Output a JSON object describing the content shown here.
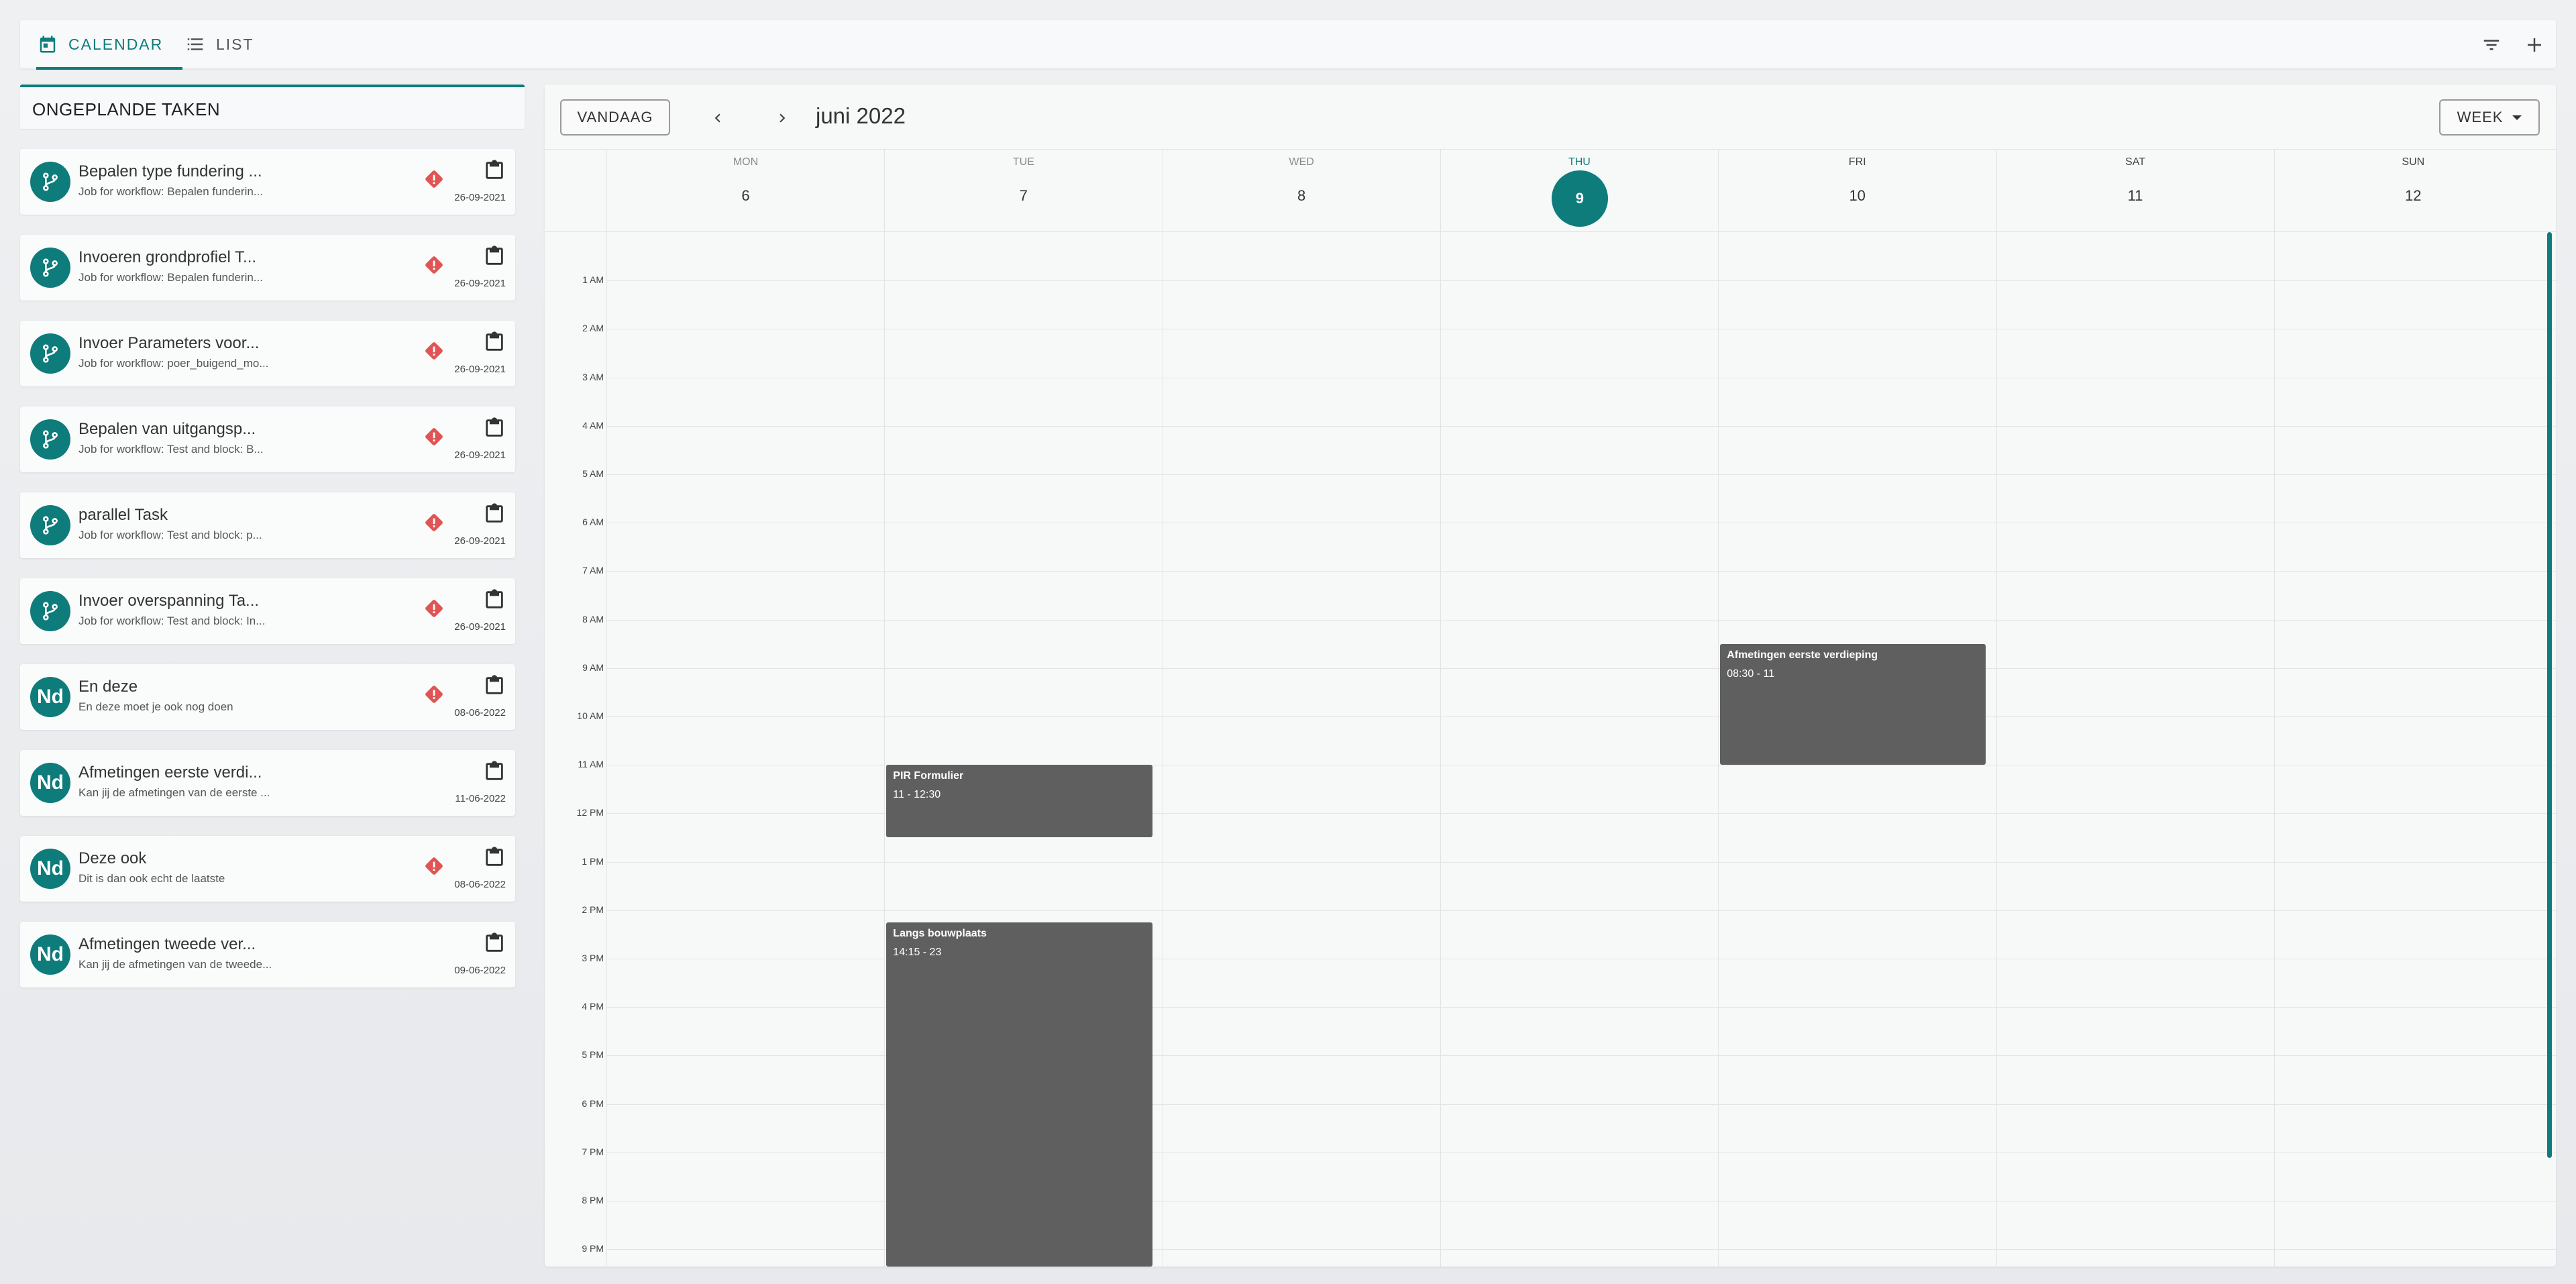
{
  "tabs": {
    "calendar": "CALENDAR",
    "list": "LIST"
  },
  "unplanned": {
    "header": "ONGEPLANDE TAKEN",
    "tasks": [
      {
        "avatar": "",
        "icon": "workflow-icon",
        "title": "Bepalen type fundering ...",
        "subtitle": "Job for workflow: Bepalen funderin...",
        "date": "26-09-2021",
        "warning": true
      },
      {
        "avatar": "",
        "icon": "workflow-icon",
        "title": "Invoeren grondprofiel T...",
        "subtitle": "Job for workflow: Bepalen funderin...",
        "date": "26-09-2021",
        "warning": true
      },
      {
        "avatar": "",
        "icon": "workflow-icon",
        "title": "Invoer Parameters voor...",
        "subtitle": "Job for workflow: poer_buigend_mo...",
        "date": "26-09-2021",
        "warning": true
      },
      {
        "avatar": "",
        "icon": "workflow-icon",
        "title": "Bepalen van uitgangsp...",
        "subtitle": "Job for workflow: Test and block: B...",
        "date": "26-09-2021",
        "warning": true
      },
      {
        "avatar": "",
        "icon": "workflow-icon",
        "title": "parallel Task",
        "subtitle": "Job for workflow: Test and block: p...",
        "date": "26-09-2021",
        "warning": true
      },
      {
        "avatar": "",
        "icon": "workflow-icon",
        "title": "Invoer overspanning Ta...",
        "subtitle": "Job for workflow: Test and block: In...",
        "date": "26-09-2021",
        "warning": true
      },
      {
        "avatar": "Nd",
        "icon": "",
        "title": "En deze",
        "subtitle": "En deze moet je ook nog doen",
        "date": "08-06-2022",
        "warning": true
      },
      {
        "avatar": "Nd",
        "icon": "",
        "title": "Afmetingen eerste verdi...",
        "subtitle": "Kan jij de afmetingen van de eerste ...",
        "date": "11-06-2022",
        "warning": false
      },
      {
        "avatar": "Nd",
        "icon": "",
        "title": "Deze ook",
        "subtitle": "Dit is dan ook echt de laatste",
        "date": "08-06-2022",
        "warning": true
      },
      {
        "avatar": "Nd",
        "icon": "",
        "title": "Afmetingen tweede ver...",
        "subtitle": "Kan jij de afmetingen van de tweede...",
        "date": "09-06-2022",
        "warning": false
      }
    ]
  },
  "calendar": {
    "today_label": "VANDAAG",
    "month": "juni 2022",
    "view_label": "WEEK",
    "accent_color": "#0e7c7b",
    "days": [
      {
        "name": "MON",
        "num": "6",
        "today": false
      },
      {
        "name": "TUE",
        "num": "7",
        "today": false
      },
      {
        "name": "WED",
        "num": "8",
        "today": false
      },
      {
        "name": "THU",
        "num": "9",
        "today": true
      },
      {
        "name": "FRI",
        "num": "10",
        "today": false
      },
      {
        "name": "SAT",
        "num": "11",
        "today": false
      },
      {
        "name": "SUN",
        "num": "12",
        "today": false
      }
    ],
    "hours": [
      "1 AM",
      "2 AM",
      "3 AM",
      "4 AM",
      "5 AM",
      "6 AM",
      "7 AM",
      "8 AM",
      "9 AM",
      "10 AM",
      "11 AM",
      "12 PM",
      "1 PM",
      "2 PM",
      "3 PM",
      "4 PM",
      "5 PM",
      "6 PM",
      "7 PM",
      "8 PM",
      "9 PM"
    ],
    "events": [
      {
        "title": "Afmetingen eerste verdieping",
        "time": "08:30 - 11",
        "day": 4,
        "start": 8.5,
        "end": 11
      },
      {
        "title": "PIR Formulier",
        "time": "11 - 12:30",
        "day": 1,
        "start": 11,
        "end": 12.5
      },
      {
        "title": "Langs bouwplaats",
        "time": "14:15 - 23",
        "day": 1,
        "start": 14.25,
        "end": 23
      }
    ]
  }
}
